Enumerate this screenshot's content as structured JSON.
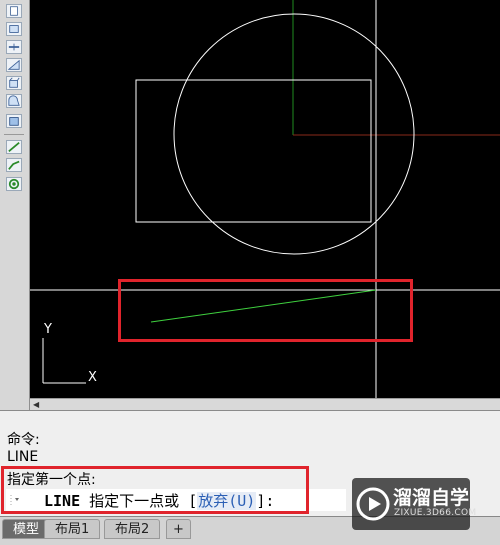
{
  "command_window": {
    "line1": "命令:",
    "line2": "LINE",
    "line3": "指定第一个点:",
    "prompt_keyword": "LINE",
    "prompt_text": "指定下一点或 [",
    "prompt_option": "放弃",
    "prompt_option_key_open": "(",
    "prompt_option_key": "U",
    "prompt_option_key_close": ")",
    "prompt_end": "]:"
  },
  "ucs": {
    "y_label": "Y",
    "x_label": "X"
  },
  "tabs": [
    {
      "label": "模型",
      "active": true
    },
    {
      "label": "布局1",
      "active": false
    },
    {
      "label": "布局2",
      "active": false
    },
    {
      "label": "+",
      "active": false
    }
  ],
  "watermark": {
    "brand": "溜溜自学",
    "url": "ZIXUE.3D66.COM"
  },
  "colors": {
    "highlight_red": "#e0242c",
    "line_green": "#3fd13f",
    "geometry_white": "#ffffff",
    "background": "#000000"
  }
}
